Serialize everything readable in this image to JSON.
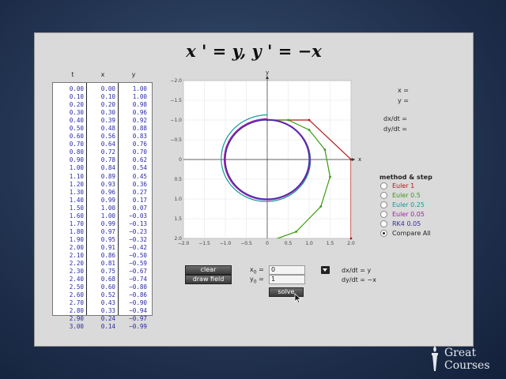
{
  "title": "x ' = y,  y ' = −x",
  "table": {
    "headers": [
      "t",
      "x",
      "y"
    ],
    "t": [
      "0.00",
      "0.10",
      "0.20",
      "0.30",
      "0.40",
      "0.50",
      "0.60",
      "0.70",
      "0.80",
      "0.90",
      "1.00",
      "1.10",
      "1.20",
      "1.30",
      "1.40",
      "1.50",
      "1.60",
      "1.70",
      "1.80",
      "1.90",
      "2.00",
      "2.10",
      "2.20",
      "2.30",
      "2.40",
      "2.50",
      "2.60",
      "2.70",
      "2.80",
      "2.90",
      "3.00"
    ],
    "x": [
      "0.00",
      "0.10",
      "0.20",
      "0.30",
      "0.39",
      "0.48",
      "0.56",
      "0.64",
      "0.72",
      "0.78",
      "0.84",
      "0.89",
      "0.93",
      "0.96",
      "0.99",
      "1.00",
      "1.00",
      "0.99",
      "0.97",
      "0.95",
      "0.91",
      "0.86",
      "0.81",
      "0.75",
      "0.68",
      "0.60",
      "0.52",
      "0.43",
      "0.33",
      "0.24",
      "0.14"
    ],
    "y": [
      "1.00",
      "1.00",
      "0.98",
      "0.96",
      "0.92",
      "0.88",
      "0.83",
      "0.76",
      "0.70",
      "0.62",
      "0.54",
      "0.45",
      "0.36",
      "0.27",
      "0.17",
      "0.07",
      "−0.03",
      "−0.13",
      "−0.23",
      "−0.32",
      "−0.42",
      "−0.50",
      "−0.59",
      "−0.67",
      "−0.74",
      "−0.80",
      "−0.86",
      "−0.90",
      "−0.94",
      "−0.97",
      "−0.99"
    ]
  },
  "plot": {
    "x_axis_label": "x",
    "y_axis_label": "y",
    "xticks": [
      "−2.0",
      "−1.5",
      "−1.0",
      "−0.5",
      "0",
      "0.5",
      "1.0",
      "1.5",
      "2.0"
    ],
    "yticks": [
      "2.0",
      "1.5",
      "1.0",
      "0.5",
      "0",
      "−0.5",
      "−1.0",
      "−1.5",
      "−2.0"
    ]
  },
  "chart_data": {
    "type": "line",
    "xlim": [
      -2,
      2
    ],
    "ylim": [
      -2,
      2
    ],
    "grid": true,
    "x_tick_values": [
      -2,
      -1.5,
      -1,
      -0.5,
      0,
      0.5,
      1,
      1.5,
      2
    ],
    "y_tick_values": [
      -2,
      -1.5,
      -1,
      -0.5,
      0,
      0.5,
      1,
      1.5,
      2
    ],
    "initial_condition": {
      "x0": 0,
      "y0": 1
    },
    "series": [
      {
        "name": "Euler 1",
        "color": "#b01818",
        "points": [
          [
            0,
            1
          ],
          [
            1,
            1
          ],
          [
            2,
            0
          ],
          [
            2,
            -2
          ]
        ]
      },
      {
        "name": "Euler 0.5",
        "color": "#3a9a12",
        "points": [
          [
            0,
            1
          ],
          [
            0.5,
            1
          ],
          [
            1,
            0.75
          ],
          [
            1.375,
            0.25
          ],
          [
            1.5,
            -0.44
          ],
          [
            1.28,
            -1.19
          ],
          [
            0.69,
            -1.83
          ],
          [
            -0.23,
            -2.18
          ]
        ]
      },
      {
        "name": "Euler 0.25",
        "color": "#0e9a9a",
        "spiral": {
          "r0": 1,
          "growth_per_radian": 0.0196,
          "turns": 1.0
        }
      },
      {
        "name": "Euler 0.05",
        "color": "#a020a8",
        "spiral": {
          "r0": 1,
          "growth_per_radian": 0.0025,
          "turns": 2.0
        }
      },
      {
        "name": "RK4 0.05",
        "color": "#3a2aa8",
        "spiral": {
          "r0": 1,
          "growth_per_radian": 0.0,
          "turns": 1.0
        }
      }
    ]
  },
  "readouts": {
    "x_label": "x =",
    "y_label": "y =",
    "dxdt_label": "dx/dt =",
    "dydt_label": "dy/dt ="
  },
  "methods": {
    "title": "method & step",
    "options": [
      {
        "label": "Euler 1",
        "color": "#b01818",
        "selected": false
      },
      {
        "label": "Euler 0.5",
        "color": "#3a9a12",
        "selected": false
      },
      {
        "label": "Euler 0.25",
        "color": "#0e9a9a",
        "selected": false
      },
      {
        "label": "Euler 0.05",
        "color": "#a020a8",
        "selected": false
      },
      {
        "label": "RK4 0.05",
        "color": "#3a2aa8",
        "selected": false
      },
      {
        "label": "Compare All",
        "color": "#222222",
        "selected": true
      }
    ]
  },
  "controls": {
    "clear_label": "clear",
    "draw_field_label": "draw field",
    "x0_label": "x",
    "x0_sub": "0",
    "y0_label": "y",
    "y0_sub": "0",
    "x0_value": "0",
    "y0_value": "1",
    "solve_label": "solve",
    "dxdt_eq": "dx/dt = y",
    "dydt_eq": "dy/dt = −x"
  },
  "logo": {
    "the": "THE",
    "great": "Great",
    "courses": "Courses"
  }
}
